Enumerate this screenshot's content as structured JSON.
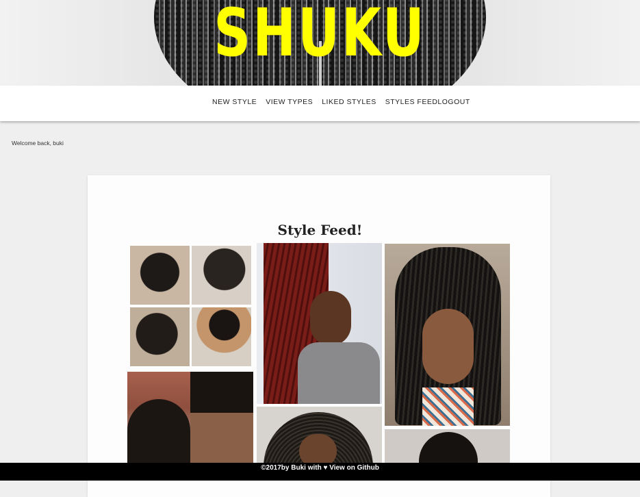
{
  "header": {
    "title": "SHUKU"
  },
  "nav": {
    "new_style": "NEW STYLE",
    "view_types": "VIEW TYPES",
    "liked_styles": "LIKED STYLES",
    "styles_feed": "STYLES FEED",
    "logout": "LOGOUT"
  },
  "welcome": "Welcome back, buki",
  "feed": {
    "title": "Style Feed!"
  },
  "footer": {
    "copyright": "©2017by Buki with ♥",
    "github": "View on Github"
  }
}
